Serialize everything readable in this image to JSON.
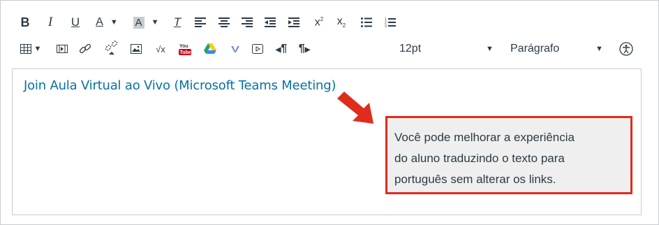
{
  "toolbar": {
    "font_size_value": "12pt",
    "block_format_value": "Parágrafo",
    "row1_icons": [
      "bold-icon",
      "italic-icon",
      "underline-icon",
      "text-color-icon",
      "background-color-icon",
      "clear-formatting-icon",
      "align-left-icon",
      "align-center-icon",
      "align-right-icon",
      "outdent-icon",
      "indent-icon",
      "superscript-icon",
      "subscript-icon",
      "bullet-list-icon",
      "numbered-list-icon"
    ],
    "row2_icons": [
      "table-icon",
      "media-icon",
      "link-icon",
      "unlink-icon",
      "image-icon",
      "equation-icon",
      "youtube-icon",
      "google-drive-icon",
      "vimeo-icon",
      "video-embed-icon",
      "ltr-paragraph-icon",
      "rtl-paragraph-icon",
      "accessibility-icon"
    ],
    "glyphs": {
      "bold": "B",
      "italic": "I",
      "underline": "U",
      "text_color": "A",
      "background_color": "A",
      "clear_format": "T",
      "superscript": "x",
      "subscript": "x",
      "pilcrow": "¶"
    }
  },
  "editor": {
    "link_text": "Join Aula Virtual ao Vivo (Microsoft Teams Meeting)",
    "link_color": "#0770a3"
  },
  "callout": {
    "lines": [
      "Você pode melhorar a experiência",
      "do aluno traduzindo o texto para",
      "português sem alterar os links."
    ],
    "border_color": "#e02c1b",
    "arrow_color": "#e02c1b"
  }
}
